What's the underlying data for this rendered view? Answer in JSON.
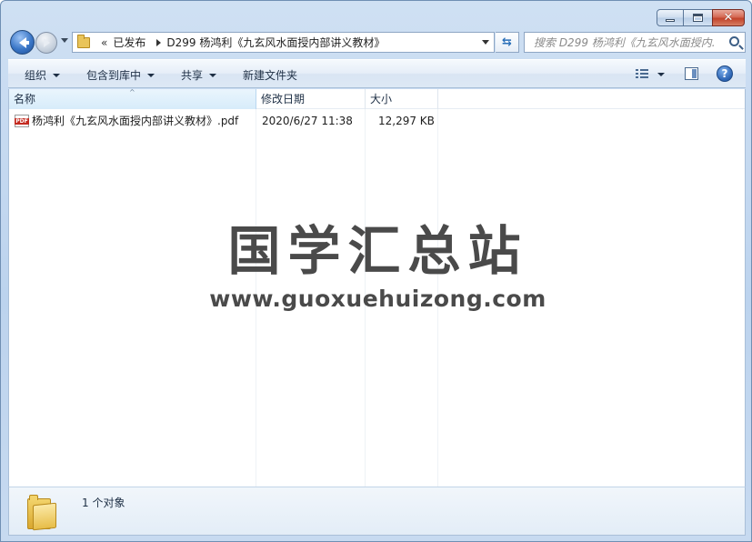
{
  "window": {
    "caption": {
      "minimize": "",
      "maximize": "",
      "close": "✕"
    }
  },
  "address": {
    "chevron": "«",
    "segments": [
      "已发布",
      "D299 杨鸿利《九玄风水面授内部讲义教材》"
    ]
  },
  "search": {
    "placeholder": "搜索 D299 杨鸿利《九玄风水面授内..."
  },
  "toolbar": {
    "organize": "组织",
    "include_library": "包含到库中",
    "share": "共享",
    "new_folder": "新建文件夹",
    "help": "?"
  },
  "columns": {
    "name": "名称",
    "modified": "修改日期",
    "size": "大小",
    "sort_indicator": "^"
  },
  "files": [
    {
      "name": "杨鸿利《九玄风水面授内部讲义教材》.pdf",
      "modified": "2020/6/27 11:38",
      "size": "12,297 KB",
      "icon": "pdf-icon"
    }
  ],
  "watermark": {
    "title": "国学汇总站",
    "url": "www.guoxuehuizong.com"
  },
  "details": {
    "count": "1 个对象"
  },
  "colors": {
    "accent": "#3a76c7",
    "watermark": "#4a4a4a",
    "pdf_badge": "#c32a1f"
  }
}
